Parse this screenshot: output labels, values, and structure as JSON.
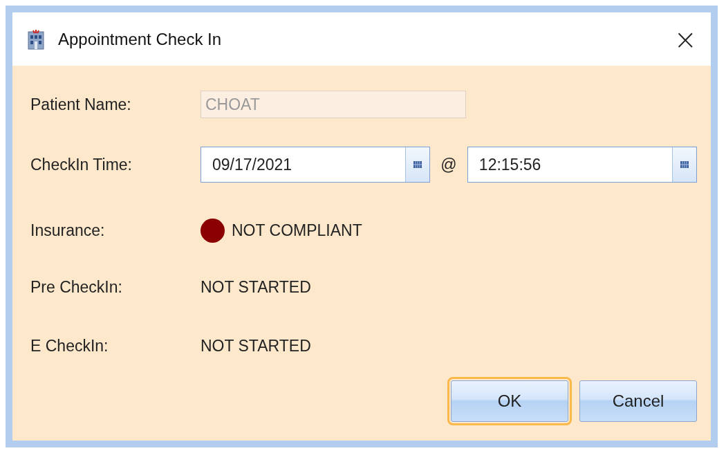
{
  "window": {
    "title": "Appointment Check In",
    "close": "×"
  },
  "patient_name": {
    "label": "Patient Name:",
    "value": "CHOAT",
    "disabled": true
  },
  "checkin_time": {
    "label": "CheckIn Time:",
    "date": "09/17/2021",
    "separator": "@",
    "time": "12:15:56"
  },
  "insurance": {
    "label": "Insurance:",
    "status": "NOT COMPLIANT",
    "color": "#8b0000"
  },
  "pre_checkin": {
    "label": "Pre CheckIn:",
    "status": "NOT STARTED"
  },
  "e_checkin": {
    "label": "E CheckIn:",
    "status": "NOT STARTED"
  },
  "buttons": [
    {
      "label": "OK",
      "focused": true
    },
    {
      "label": "Cancel",
      "focused": false
    }
  ]
}
